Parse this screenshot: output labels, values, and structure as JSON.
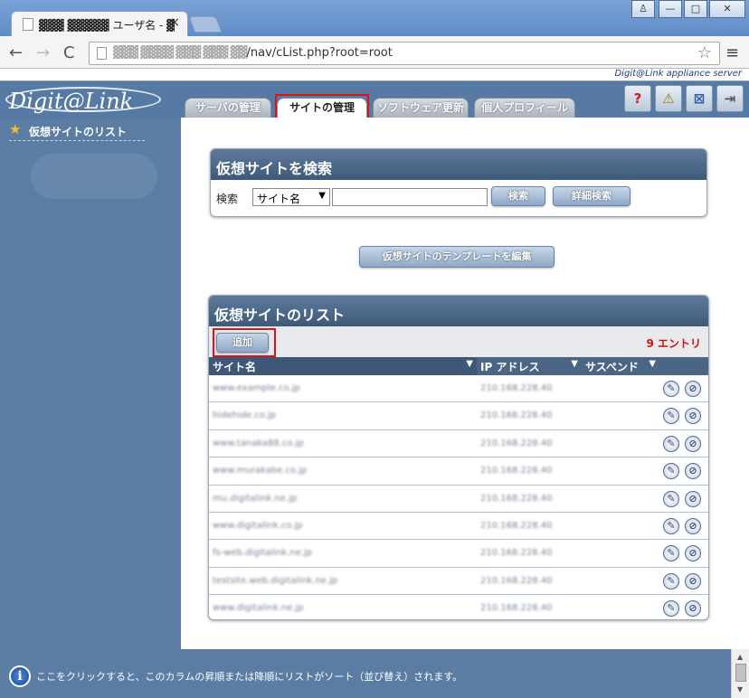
{
  "browser": {
    "tab_title": "▓▓▓ ▓▓▓▓▓ ユーザ名 - ▓",
    "tab_close": "×",
    "url_host": "▓▓▓ ▓▓▓▓ ▓▓▓ ▓▓▓ ▓▓",
    "url_path": "/nav/cList.php?root=root",
    "window_controls": {
      "user": "♙",
      "minimize": "—",
      "maximize": "□",
      "close": "✕"
    },
    "nav": {
      "back": "←",
      "forward": "→",
      "reload": "C",
      "star": "☆",
      "menu": "≡"
    }
  },
  "app": {
    "brand_small": "Digit@Link appliance server",
    "logo": "Digit@Link",
    "tabs": [
      {
        "label": "サーバの管理",
        "active": false
      },
      {
        "label": "サイトの管理",
        "active": true
      },
      {
        "label": "ソフトウェア更新",
        "active": false
      },
      {
        "label": "個人プロフィール",
        "active": false
      }
    ],
    "header_icons": [
      {
        "name": "help-icon",
        "glyph": "?"
      },
      {
        "name": "warning-icon",
        "glyph": "⚠"
      },
      {
        "name": "window-icon",
        "glyph": "⊠"
      },
      {
        "name": "logout-icon",
        "glyph": "⇥"
      }
    ]
  },
  "sidebar": {
    "items": [
      {
        "label": "仮想サイトのリスト",
        "icon": "star-icon"
      }
    ]
  },
  "search": {
    "title": "仮想サイトを検索",
    "label": "検索",
    "select_value": "サイト名",
    "input_value": "",
    "search_button": "検索",
    "advanced_button": "詳細検索"
  },
  "template_button": "仮想サイトのテンプレートを編集",
  "list": {
    "title": "仮想サイトのリスト",
    "add_button": "追加",
    "entry_count": "9 エントリ",
    "columns": [
      "サイト名",
      "IP アドレス",
      "サスペンド"
    ],
    "rows": [
      {
        "name": "www.example.co.jp",
        "ip": "210.168.228.40"
      },
      {
        "name": "hidehide.co.jp",
        "ip": "210.168.228.40"
      },
      {
        "name": "www.tanaka88.co.jp",
        "ip": "210.168.228.40"
      },
      {
        "name": "www.murakabe.co.jp",
        "ip": "210.168.228.40"
      },
      {
        "name": "mu.digitalink.ne.jp",
        "ip": "210.168.228.40"
      },
      {
        "name": "www.digitalink.co.jp",
        "ip": "210.168.228.40"
      },
      {
        "name": "fs-web.digitalink.ne.jp",
        "ip": "210.168.228.40"
      },
      {
        "name": "testsite.web.digitalink.ne.jp",
        "ip": "210.168.228.40"
      },
      {
        "name": "www.digitalink.ne.jp",
        "ip": "210.168.228.40"
      }
    ]
  },
  "status_bar": {
    "text": "ここをクリックすると、このカラムの昇順または降順にリストがソート（並び替え）されます。"
  },
  "colors": {
    "accent": "#3e5a79",
    "highlight": "#d8141c",
    "entry_count": "#cc1111"
  }
}
